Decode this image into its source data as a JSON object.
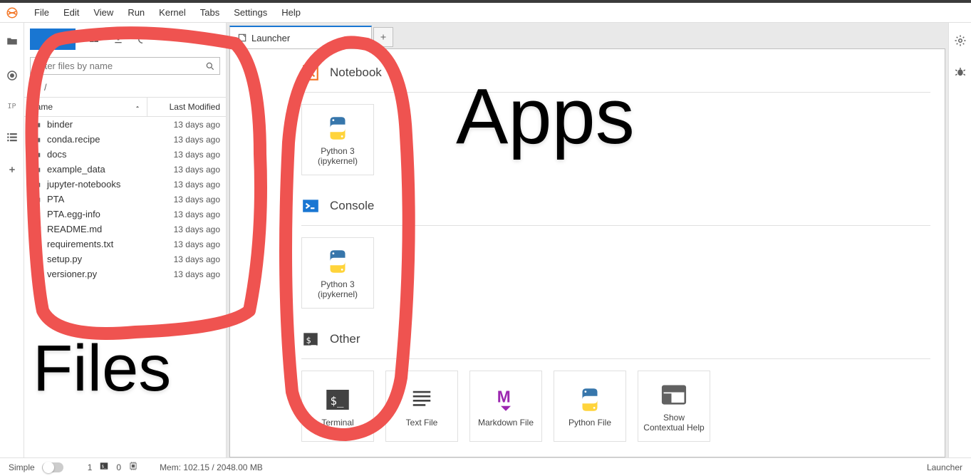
{
  "menu": {
    "items": [
      "File",
      "Edit",
      "View",
      "Run",
      "Kernel",
      "Tabs",
      "Settings",
      "Help"
    ]
  },
  "filebrowser": {
    "search_placeholder": "Filter files by name",
    "breadcrumb": "/",
    "header_name": "Name",
    "header_modified": "Last Modified",
    "rows": [
      {
        "name": "binder",
        "mod": "13 days ago",
        "type": "folder"
      },
      {
        "name": "conda.recipe",
        "mod": "13 days ago",
        "type": "folder"
      },
      {
        "name": "docs",
        "mod": "13 days ago",
        "type": "folder"
      },
      {
        "name": "example_data",
        "mod": "13 days ago",
        "type": "folder"
      },
      {
        "name": "jupyter-notebooks",
        "mod": "13 days ago",
        "type": "folder"
      },
      {
        "name": "PTA",
        "mod": "13 days ago",
        "type": "folder"
      },
      {
        "name": "PTA.egg-info",
        "mod": "13 days ago",
        "type": "folder"
      },
      {
        "name": "README.md",
        "mod": "13 days ago",
        "type": "md"
      },
      {
        "name": "requirements.txt",
        "mod": "13 days ago",
        "type": "file"
      },
      {
        "name": "setup.py",
        "mod": "13 days ago",
        "type": "py"
      },
      {
        "name": "versioner.py",
        "mod": "13 days ago",
        "type": "py"
      }
    ]
  },
  "tab": {
    "title": "Launcher"
  },
  "launcher": {
    "sections": {
      "notebook": {
        "title": "Notebook",
        "cards": [
          {
            "l1": "Python 3",
            "l2": "(ipykernel)",
            "icon": "python"
          }
        ]
      },
      "console": {
        "title": "Console",
        "cards": [
          {
            "l1": "Python 3",
            "l2": "(ipykernel)",
            "icon": "python"
          }
        ]
      },
      "other": {
        "title": "Other",
        "cards": [
          {
            "l1": "Terminal",
            "icon": "terminal"
          },
          {
            "l1": "Text File",
            "icon": "text"
          },
          {
            "l1": "Markdown File",
            "icon": "md"
          },
          {
            "l1": "Python File",
            "icon": "python"
          },
          {
            "l1": "Show",
            "l2": "Contextual Help",
            "icon": "help"
          }
        ]
      }
    }
  },
  "status": {
    "simple": "Simple",
    "num1": "1",
    "num0": "0",
    "mem": "Mem: 102.15 / 2048.00 MB",
    "right": "Launcher"
  },
  "annotations": {
    "files": "Files",
    "apps": "Apps"
  }
}
